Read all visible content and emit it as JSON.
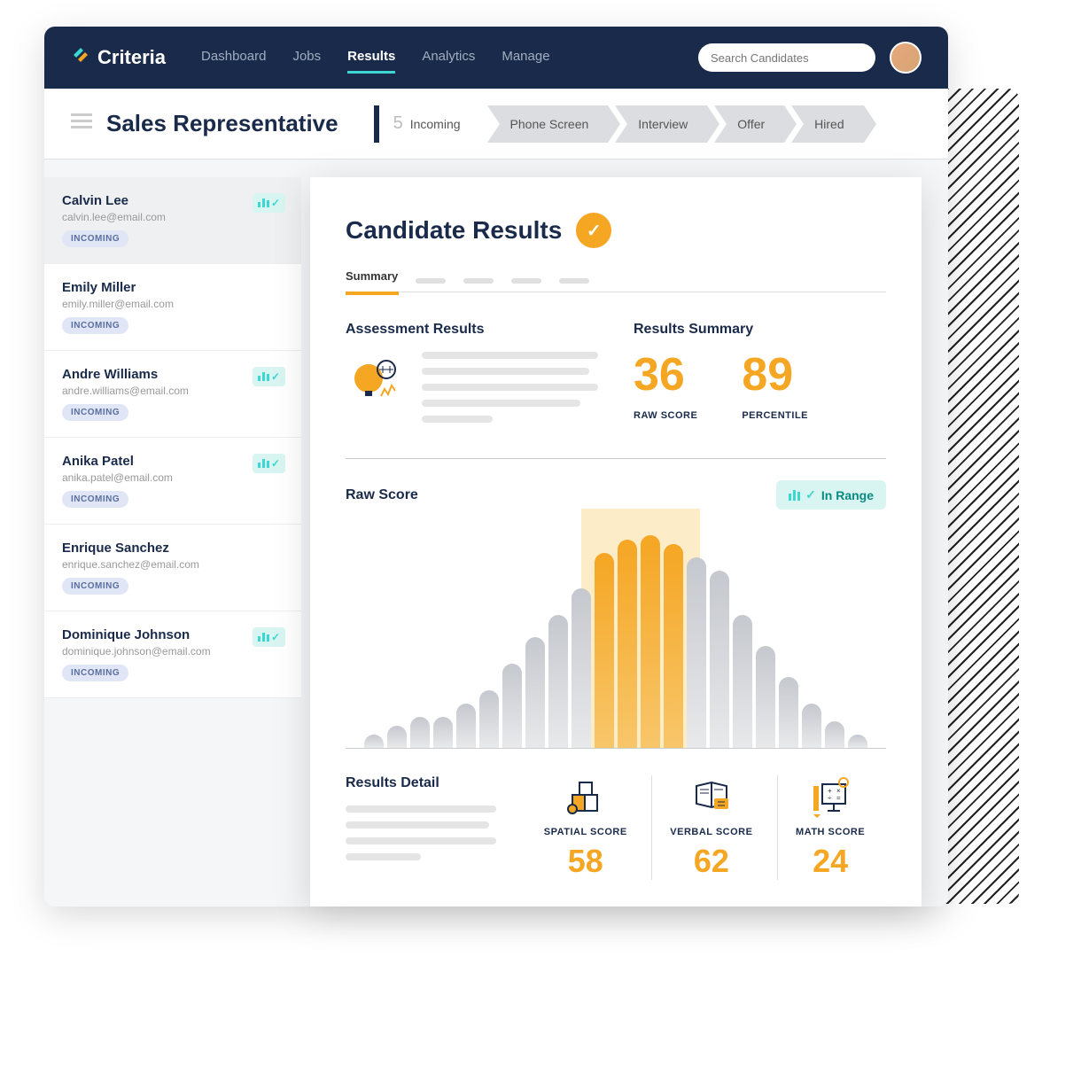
{
  "brand": "Criteria",
  "nav": {
    "items": [
      "Dashboard",
      "Jobs",
      "Results",
      "Analytics",
      "Manage"
    ],
    "active": "Results"
  },
  "search": {
    "placeholder": "Search Candidates"
  },
  "page_title": "Sales Representative",
  "pipeline": {
    "stages": [
      {
        "label": "Incoming",
        "count": "5",
        "active": true
      },
      {
        "label": "Phone Screen"
      },
      {
        "label": "Interview"
      },
      {
        "label": "Offer"
      },
      {
        "label": "Hired"
      }
    ]
  },
  "candidates": [
    {
      "name": "Calvin Lee",
      "email": "calvin.lee@email.com",
      "status": "INCOMING",
      "badge": true,
      "selected": true
    },
    {
      "name": "Emily Miller",
      "email": "emily.miller@email.com",
      "status": "INCOMING",
      "badge": false
    },
    {
      "name": "Andre Williams",
      "email": "andre.williams@email.com",
      "status": "INCOMING",
      "badge": true
    },
    {
      "name": "Anika Patel",
      "email": "anika.patel@email.com",
      "status": "INCOMING",
      "badge": true
    },
    {
      "name": "Enrique Sanchez",
      "email": "enrique.sanchez@email.com",
      "status": "INCOMING",
      "badge": false
    },
    {
      "name": "Dominique Johnson",
      "email": "dominique.johnson@email.com",
      "status": "INCOMING",
      "badge": true
    }
  ],
  "results": {
    "title": "Candidate Results",
    "tab_active": "Summary",
    "assessment_heading": "Assessment Results",
    "summary_heading": "Results Summary",
    "raw_score": {
      "value": "36",
      "label": "RAW SCORE"
    },
    "percentile": {
      "value": "89",
      "label": "PERCENTILE"
    },
    "raw_score_heading": "Raw Score",
    "in_range_label": "In Range",
    "detail_heading": "Results Detail",
    "details": [
      {
        "label": "SPATIAL SCORE",
        "value": "58"
      },
      {
        "label": "VERBAL SCORE",
        "value": "62"
      },
      {
        "label": "MATH SCORE",
        "value": "24"
      }
    ]
  },
  "chart_data": {
    "type": "bar",
    "title": "Raw Score",
    "values": [
      15,
      25,
      35,
      35,
      50,
      65,
      95,
      125,
      150,
      180,
      220,
      235,
      240,
      230,
      215,
      200,
      150,
      115,
      80,
      50,
      30,
      15
    ],
    "highlighted_range": [
      10,
      14
    ],
    "orange_highlight": [
      10,
      11,
      12,
      13
    ],
    "ylabel": "",
    "xlabel": ""
  }
}
